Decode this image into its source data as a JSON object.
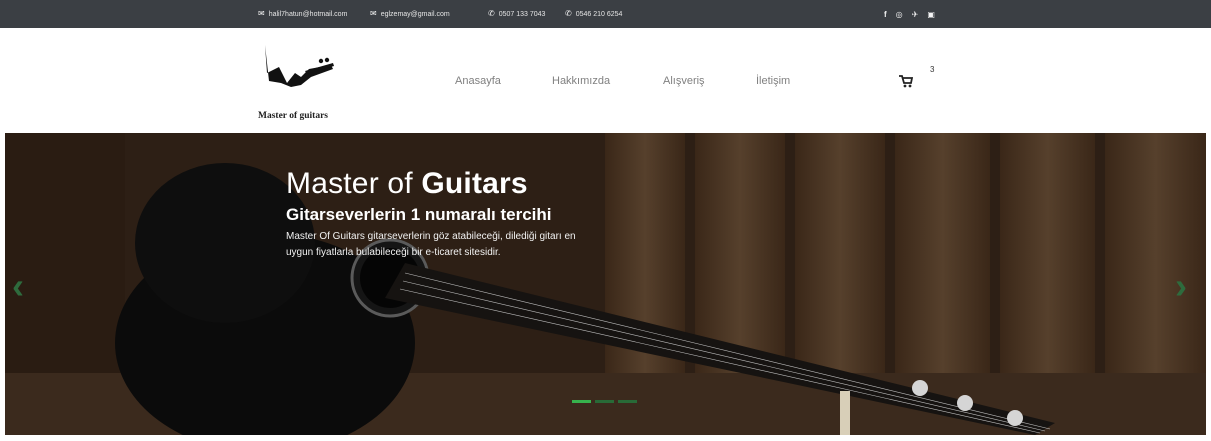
{
  "topbar": {
    "email_icon": "envelope-icon",
    "phone_icon": "phone-icon",
    "email1": "halil7hatun@hotmail.com",
    "email2": "eglzemay@gmail.com",
    "phone1": "0507 133 7043",
    "phone2": "0546 210 6254",
    "social_icons": [
      "facebook-icon",
      "instagram-icon",
      "twitter-icon",
      "youtube-icon"
    ]
  },
  "brand": {
    "name": "Master of guitars"
  },
  "nav": {
    "items": [
      "Anasayfa",
      "Hakkımızda",
      "Alışveriş",
      "İletişim"
    ]
  },
  "cart": {
    "icon": "cart-icon",
    "count": "3"
  },
  "hero": {
    "title_light": "Master of ",
    "title_bold": "Guitars",
    "subtitle": "Gitarseverlerin 1 numaralı tercihi",
    "description": "Master Of Guitars gitarseverlerin göz atabileceği, dilediği gitarı en uygun fiyatlarla bulabileceği bir e-ticaret sitesidir.",
    "prev_icon": "chevron-left-icon",
    "next_icon": "chevron-right-icon",
    "slide_count": 3,
    "active_slide": 1
  },
  "colors": {
    "topbar_bg": "#3b3f44",
    "arrow": "#2e6b3d",
    "indicator_active": "#37b24d",
    "nav_text": "#808080"
  }
}
